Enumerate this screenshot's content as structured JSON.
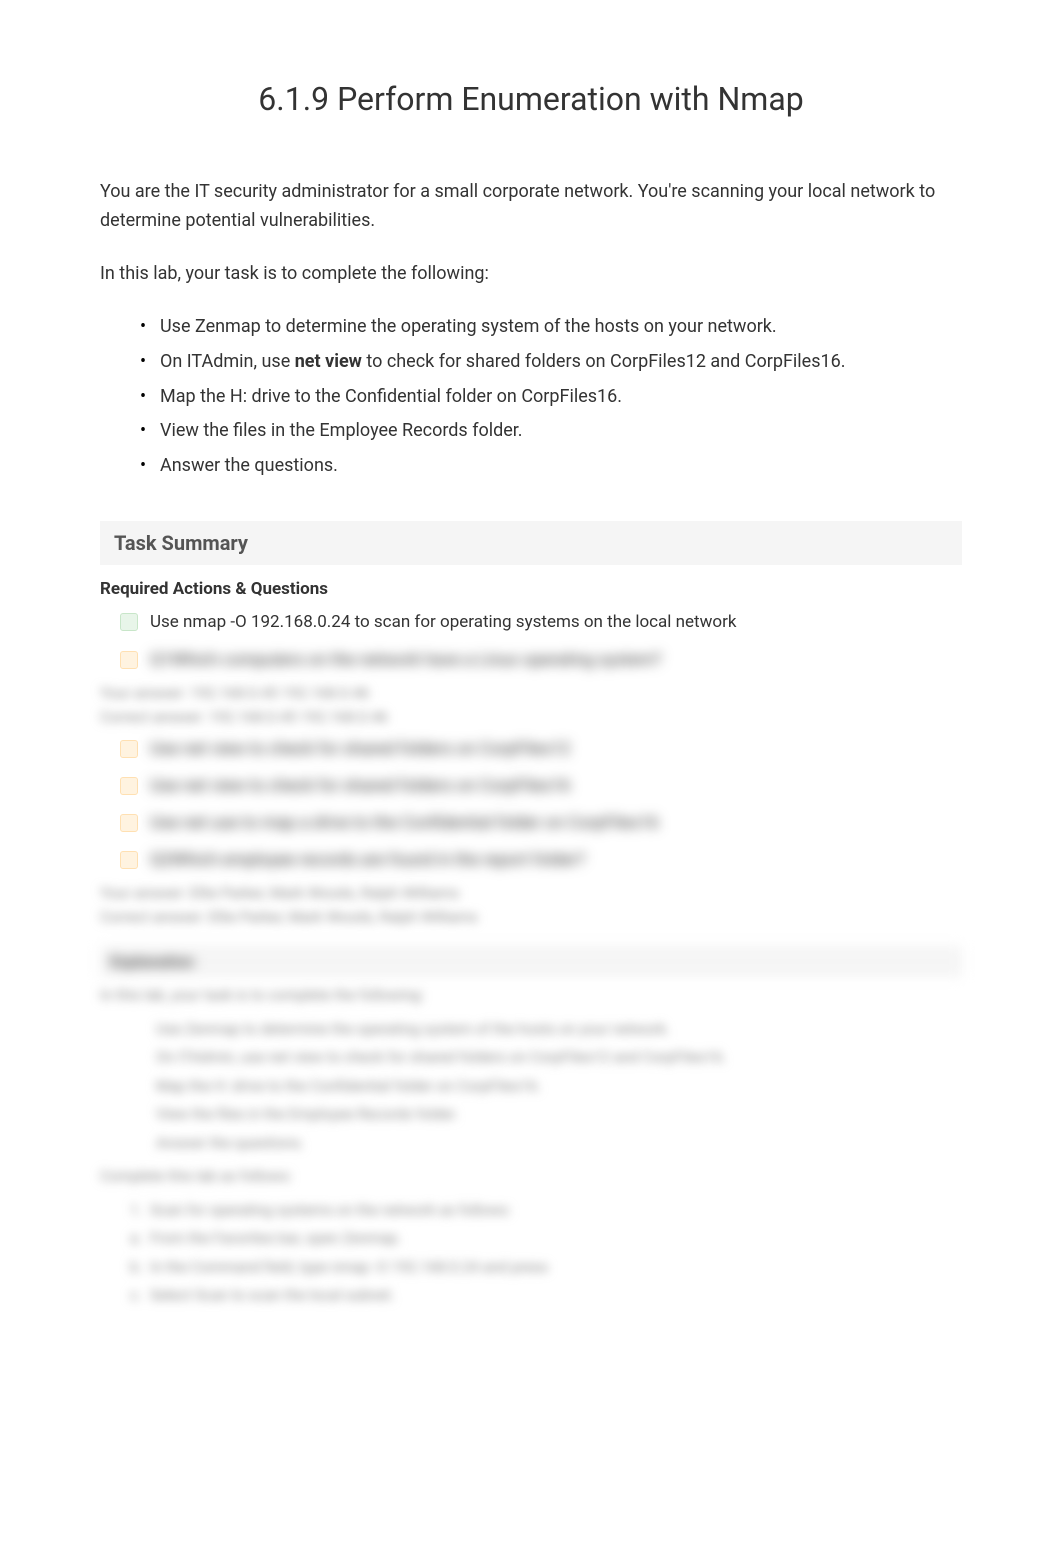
{
  "title": "6.1.9 Perform Enumeration with Nmap",
  "intro": "You are the IT security administrator for a small corporate network. You're scanning your local network to determine potential vulnerabilities.",
  "subintro": "In this lab, your task is to complete the following:",
  "bullets": [
    "Use Zenmap to determine the operating system of the hosts on your network.",
    "On ITAdmin, use net view to check for shared folders on CorpFiles12 and CorpFiles16.",
    "Map the H: drive to the Confidential folder on CorpFiles16.",
    "View the files in the Employee Records folder.",
    "Answer the questions."
  ],
  "bullet_bold_segment": "net view",
  "task_summary_heading": "Task Summary",
  "required_heading": "Required Actions & Questions",
  "actions": [
    {
      "check": "green",
      "text": "Use nmap -O 192.168.0.24 to scan for operating systems on the local network",
      "blur": false
    },
    {
      "check": "orange",
      "text": "Q1Which computers on the network have a Linux operating system?",
      "blur": true
    }
  ],
  "answer_lines_1": [
    "Your answer: 192.168.0.45   192.168.0.46",
    "Correct answer: 192.168.0.45   192.168.0.46"
  ],
  "actions2": [
    {
      "check": "orange",
      "text": "Use net view to check for shared folders on CorpFiles12",
      "blur": true
    },
    {
      "check": "orange",
      "text": "Use net view to check for shared folders on CorpFiles16",
      "blur": true
    },
    {
      "check": "orange",
      "text": "Use net use to map a drive to the Confidential folder on CorpFiles16",
      "blur": true
    },
    {
      "check": "orange",
      "text": "Q2Which employee records are found in the report folder?",
      "blur": true
    }
  ],
  "answer_lines_2": [
    "Your answer: Ellie Parker, Mark Woods, Ralph Williams",
    "Correct answer: Ellie Parker, Mark Woods, Ralph Williams"
  ],
  "explanation_heading": "Explanation",
  "explanation_intro": "In this lab, your task is to complete the following:",
  "explanation_bullets": [
    "Use Zenmap to determine the operating system of the hosts on your network.",
    "On ITAdmin, use net view to check for shared folders on CorpFiles12 and CorpFiles16.",
    "Map the H: drive to the Confidential folder on CorpFiles16.",
    "View the files in the Employee Records folder.",
    "Answer the questions."
  ],
  "explanation_steps_intro": "Complete this lab as follows:",
  "explanation_steps": [
    "Scan for operating systems on the network as follows:",
    "From the Favorites bar, open Zenmap.",
    "In the Command field, type nmap -O 192.168.0.24 and press",
    "Select Scan to scan the local subnet."
  ]
}
